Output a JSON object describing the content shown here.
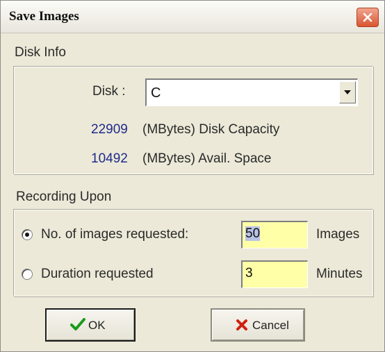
{
  "window": {
    "title": "Save Images"
  },
  "disk_info": {
    "group_label": "Disk Info",
    "disk_label": "Disk :",
    "disk_value": "C",
    "capacity_value": "22909",
    "capacity_label": "(MBytes) Disk Capacity",
    "avail_value": "10492",
    "avail_label": "(MBytes) Avail. Space"
  },
  "recording": {
    "group_label": "Recording Upon",
    "option_images": {
      "label": "No. of images requested:",
      "checked": true,
      "value": "50",
      "unit": "Images"
    },
    "option_duration": {
      "label": "Duration requested",
      "checked": false,
      "value": "3",
      "unit": "Minutes"
    }
  },
  "buttons": {
    "ok_label": "OK",
    "cancel_label": "Cancel"
  },
  "icons": {
    "close": "close-icon",
    "dropdown": "chevron-down-icon",
    "ok": "checkmark-icon",
    "cancel": "x-mark-icon"
  },
  "colors": {
    "value_text": "#1f2a8a",
    "input_background": "#ffffa8",
    "ok_icon": "#1a9a1a",
    "cancel_icon": "#d02010",
    "close_button": "#d9552f"
  }
}
